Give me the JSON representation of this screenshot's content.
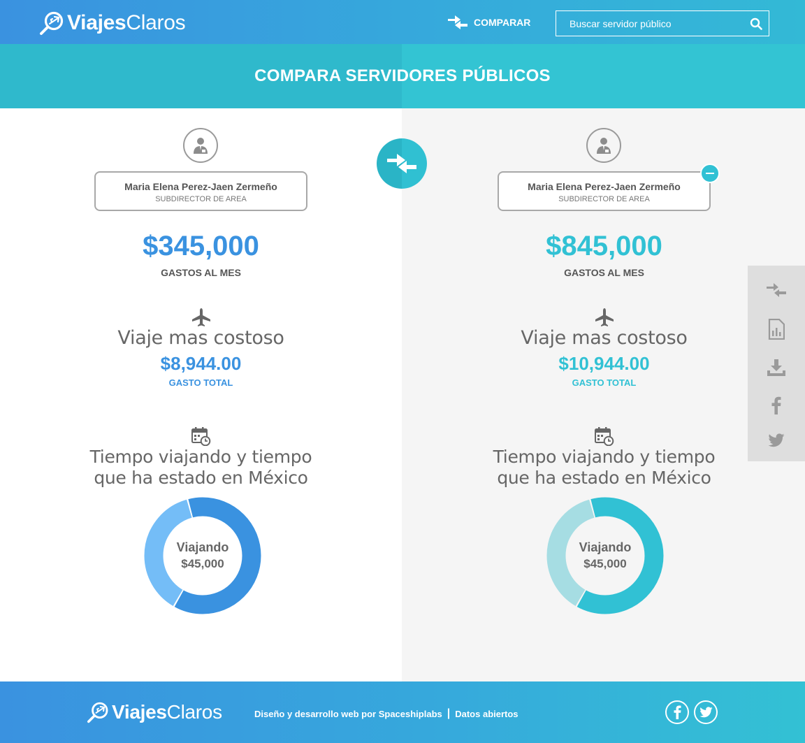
{
  "header": {
    "logo_bold": "Viajes",
    "logo_light": "Claros",
    "compare_label": "COMPARAR",
    "search_placeholder": "Buscar servidor público"
  },
  "banner": {
    "title": "COMPARA SERVIDORES PÚBLICOS"
  },
  "colors": {
    "left_accent": "#3a92e0",
    "left_accent_light": "#74bdf7",
    "right_accent": "#31c1d4",
    "right_accent_light": "#a6dde3"
  },
  "left": {
    "name": "Maria Elena Perez-Jaen Zermeño",
    "role": "SUBDIRECTOR DE AREA",
    "monthly_amount": "$345,000",
    "monthly_label": "GASTOS AL MES",
    "trip_title": "Viaje mas costoso",
    "trip_amount": "$8,944.00",
    "trip_label": "GASTO TOTAL",
    "time_title_line1": "Tiempo viajando y tiempo",
    "time_title_line2": "que ha estado en México",
    "donut_label": "Viajando",
    "donut_value": "$45,000",
    "donut_fraction_traveling": 0.62
  },
  "right": {
    "name": "Maria Elena Perez-Jaen Zermeño",
    "role": "SUBDIRECTOR DE AREA",
    "monthly_amount": "$845,000",
    "monthly_label": "GASTOS AL MES",
    "trip_title": "Viaje mas costoso",
    "trip_amount": "$10,944.00",
    "trip_label": "GASTO TOTAL",
    "time_title_line1": "Tiempo viajando y tiempo",
    "time_title_line2": "que ha estado en México",
    "donut_label": "Viajando",
    "donut_value": "$45,000",
    "donut_fraction_traveling": 0.62
  },
  "sidebar": {
    "icons": [
      "compare-icon",
      "report-icon",
      "download-icon",
      "facebook-icon",
      "twitter-icon"
    ]
  },
  "footer": {
    "logo_bold": "Viajes",
    "logo_light": "Claros",
    "credits": "Diseño y desarrollo web por Spaceshiplabs",
    "separator": "|",
    "open_data": "Datos abiertos"
  }
}
